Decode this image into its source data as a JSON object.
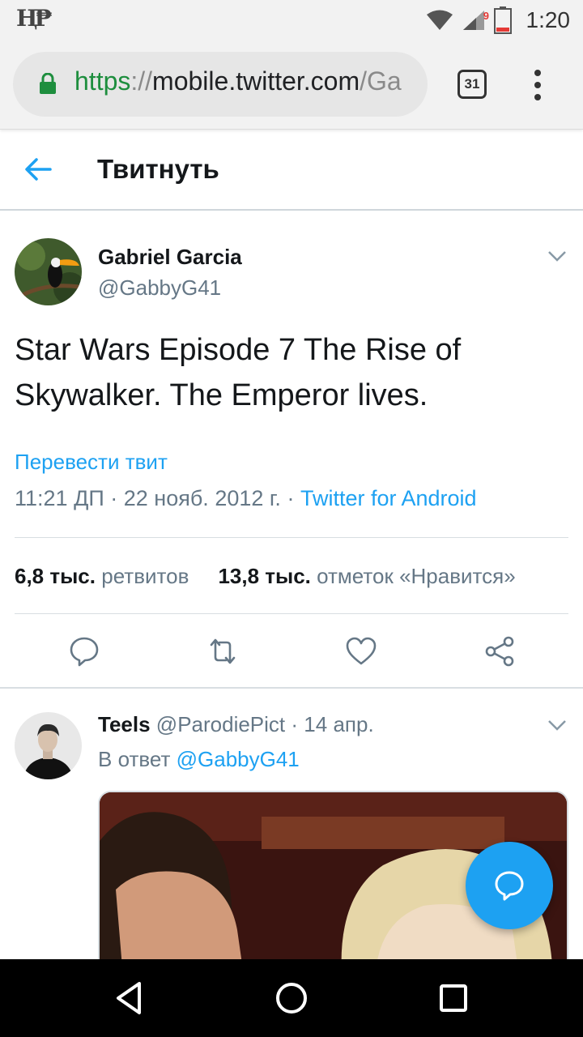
{
  "status_bar": {
    "time": "1:20",
    "battery_level": "9",
    "icons": [
      "hp-logo-icon",
      "wifi-icon",
      "signal-icon",
      "battery-icon"
    ]
  },
  "browser": {
    "url_scheme": "https",
    "url_separator": "://",
    "url_host": "mobile.twitter.com",
    "url_path": "/Ga",
    "tab_count": "31"
  },
  "header": {
    "title": "Твитнуть"
  },
  "tweet": {
    "author_name": "Gabriel Garcia",
    "author_handle": "@GabbyG41",
    "text": "Star Wars Episode 7 The Rise of Skywalker. The Emperor lives.",
    "translate_label": "Перевести твит",
    "time": "11:21 ДП",
    "separator": " · ",
    "date": "22 нояб. 2012 г.",
    "source": "Twitter for Android",
    "retweets_count": "6,8 тыс.",
    "retweets_label": "ретвитов",
    "likes_count": "13,8 тыс.",
    "likes_label": "отметок «Нравится»"
  },
  "reply": {
    "name": "Teels",
    "handle": "@ParodiePict",
    "dot": "·",
    "date": "14 апр.",
    "in_reply_prefix": "В ответ",
    "in_reply_handle": "@GabbyG41"
  },
  "colors": {
    "twitter_blue": "#1da1f2",
    "secure_green": "#1e8e3e",
    "secondary_text": "#657786",
    "primary_text": "#14171a"
  }
}
